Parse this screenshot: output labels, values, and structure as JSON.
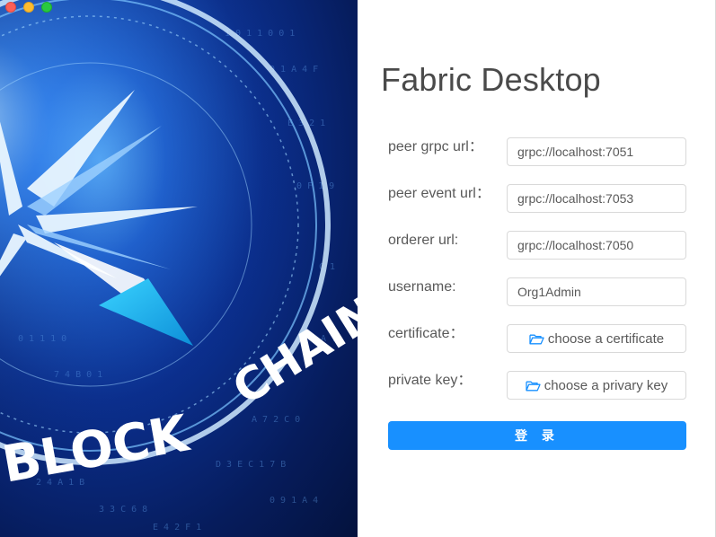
{
  "app": {
    "title": "Fabric Desktop"
  },
  "window_controls": [
    "close",
    "minimize",
    "zoom"
  ],
  "hero": {
    "text": "BLOCK CHAIN"
  },
  "form": {
    "fields": [
      {
        "label": "peer grpc url：",
        "value": "grpc://localhost:7051"
      },
      {
        "label": "peer event url：",
        "value": "grpc://localhost:7053"
      },
      {
        "label": "orderer url:",
        "value": "grpc://localhost:7050"
      },
      {
        "label": "username:",
        "value": "Org1Admin"
      }
    ],
    "certificate": {
      "label": "certificate：",
      "button": "choose a certificate",
      "icon": "folder-open-icon"
    },
    "private_key": {
      "label": "private key：",
      "button": "choose a privary key",
      "icon": "folder-open-icon"
    },
    "submit_label": "登 录"
  },
  "colors": {
    "primary": "#1890ff",
    "title": "#4a4a4a",
    "label": "#595959",
    "border": "#d9d9d9"
  }
}
